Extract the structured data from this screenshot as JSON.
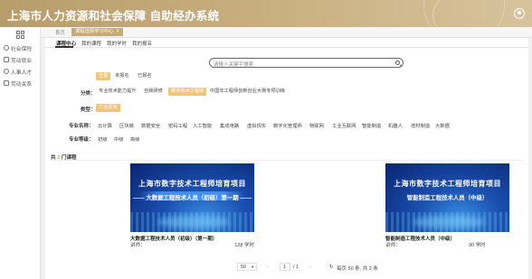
{
  "header": {
    "title": "上海市人力资源和社会保障",
    "subtitle": "自助经办系统"
  },
  "sidebar": {
    "items": [
      {
        "label": "社会保险",
        "icon": "shield-icon"
      },
      {
        "label": "劳动就业",
        "icon": "briefcase-icon"
      },
      {
        "label": "人事人才",
        "icon": "person-icon"
      },
      {
        "label": "劳动关系",
        "icon": "document-icon"
      }
    ]
  },
  "tabs": {
    "home": "首页",
    "active": "课程选择学习中心",
    "close": "×"
  },
  "subnav": {
    "items": [
      "课程中心",
      "我的课程",
      "我的学时",
      "我的报名"
    ]
  },
  "search": {
    "placeholder": "请输入关键字搜索"
  },
  "filters": {
    "status": {
      "items": [
        "全部",
        "未报名",
        "已报名"
      ],
      "selected": "全部"
    },
    "category": {
      "label": "分类：",
      "items": [
        "专业技术能力提升",
        "自我研修",
        "数字技术工程师",
        "中国年工程师创新创业大赛专项训练"
      ],
      "selected": "数字技术工程师"
    },
    "type": {
      "label": "类型：",
      "items": [
        "工业项目"
      ],
      "selected": "工业项目"
    },
    "major": {
      "label": "专业名称：",
      "items": [
        "云计算",
        "区块链",
        "数据安全",
        "密码工程",
        "人工智能",
        "集成电路",
        "虚拟现实",
        "数字化管理师",
        "物联网",
        "工业互联网",
        "智能制造",
        "机器人",
        "增材制造",
        "大数据"
      ]
    },
    "level": {
      "label": "专业等级：",
      "items": [
        "初级",
        "中级",
        "高级"
      ]
    }
  },
  "result": {
    "prefix": "共",
    "count": "2",
    "suffix": "门课程"
  },
  "courses": [
    {
      "banner_title": "上海市数字技术工程师培育项目",
      "banner_subtitle": "—— 大数据工程技术人员（初级）第一期 ——",
      "title": "大数据工程技术人员（初级）（第一期）",
      "teacher_label": "讲师：",
      "hours": "128 学时"
    },
    {
      "banner_title": "上海市数字技术工程师培育项目",
      "banner_subtitle": "智能制造工程技术人员（中级）",
      "title": "智能制造工程技术人员（中级）",
      "teacher_label": "讲师：",
      "hours": "90 学时"
    }
  ],
  "pagination": {
    "page_size": "50",
    "current": "1",
    "total_pages": "/ 1",
    "summary": "每页 50 条, 共 2 条",
    "prev": "‹",
    "next": "›",
    "refresh": "↻"
  },
  "colors": {
    "accent": "#c8ab73",
    "selected_chip": "#f0c57a"
  }
}
